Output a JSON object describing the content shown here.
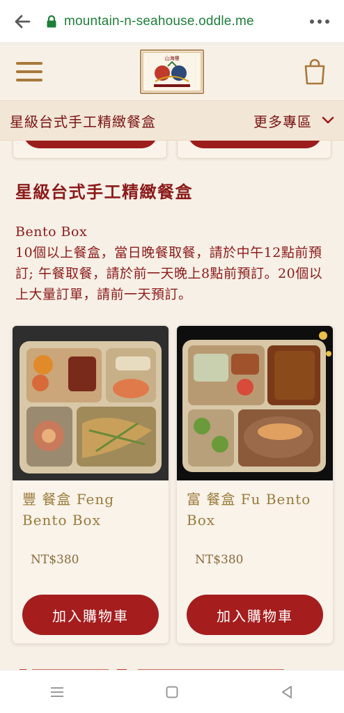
{
  "browser": {
    "url": "mountain-n-seahouse.oddle.me"
  },
  "header": {
    "logo_text": "山海樓"
  },
  "category_bar": {
    "title": "星級台式手工精緻餐盒",
    "more_label": "更多專區"
  },
  "section": {
    "title": "星級台式手工精緻餐盒",
    "description_line1": "Bento Box",
    "description_line2": "10個以上餐盒，當日晚餐取餐，請於中午12點前預訂; 午餐取餐，請於前一天晚上8點前預訂。20個以上大量訂單，請前一天預訂。"
  },
  "products": [
    {
      "name": "豐 餐盒  Feng Bento Box",
      "price": "NT$380",
      "button": "加入購物車"
    },
    {
      "name": "富 餐盒  Fu Bento Box",
      "price": "NT$380",
      "button": "加入購物車"
    }
  ],
  "colors": {
    "brand_red": "#a51d1d",
    "title_red": "#8b1a1a",
    "gold": "#9a7a3a",
    "url_green": "#1e7f3a",
    "background": "#f7f0e6"
  }
}
